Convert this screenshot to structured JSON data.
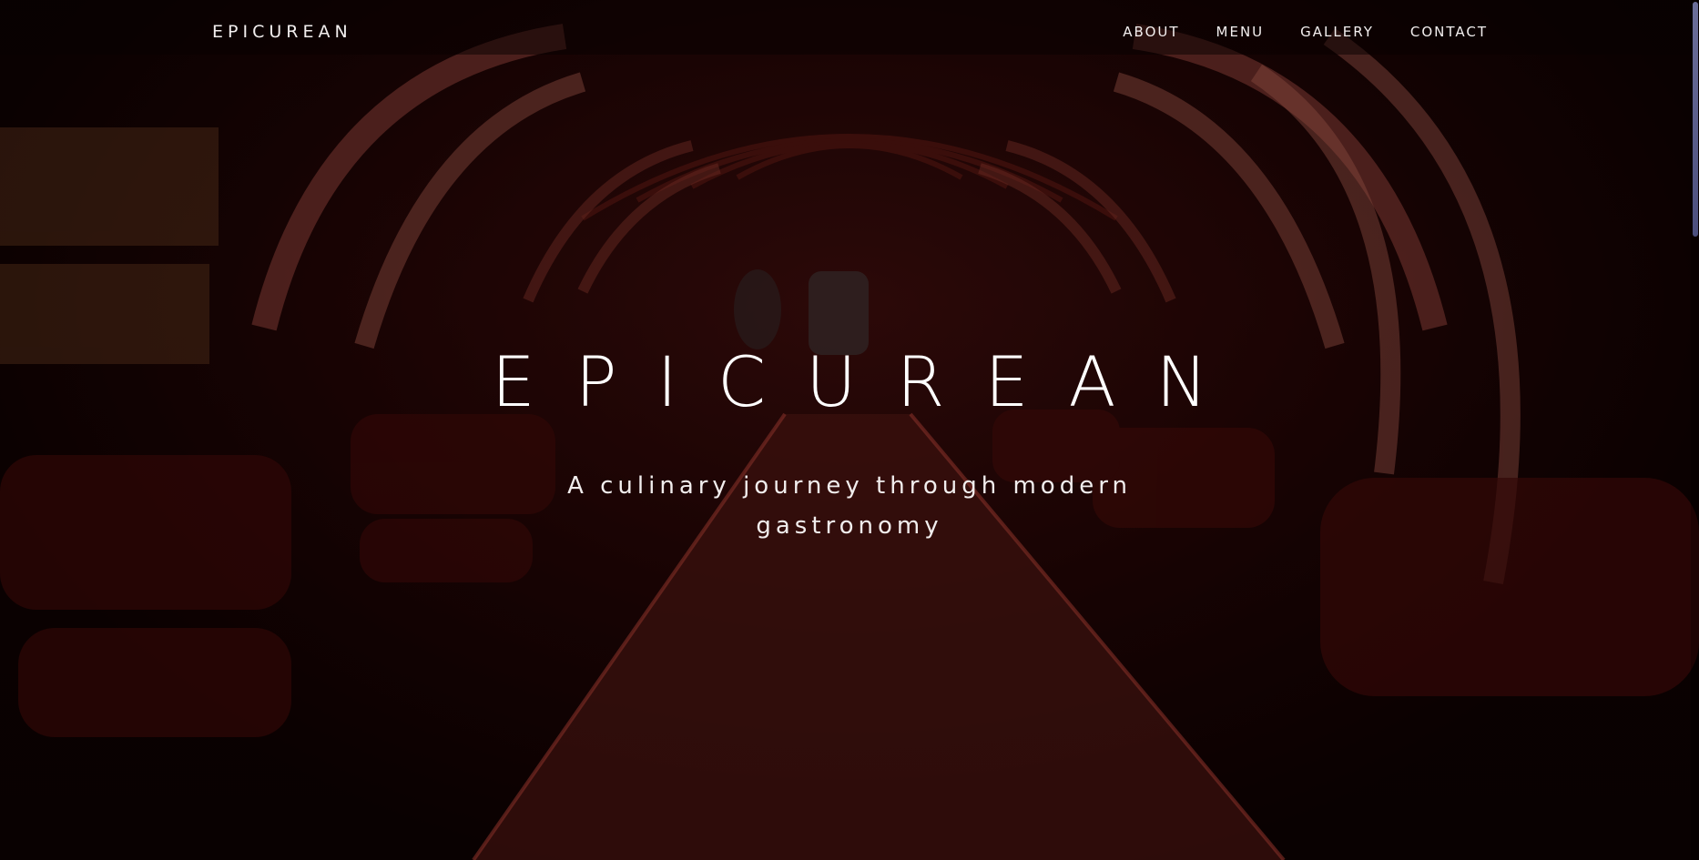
{
  "header": {
    "logo": "EPICUREAN",
    "nav": [
      {
        "label": "ABOUT"
      },
      {
        "label": "MENU"
      },
      {
        "label": "GALLERY"
      },
      {
        "label": "CONTACT"
      }
    ]
  },
  "hero": {
    "title": "EPICUREAN",
    "subtitle": "A culinary journey through modern gastronomy",
    "background": "restaurant-interior-photo"
  },
  "colors": {
    "accent": "#b3332a",
    "text": "#ffffff",
    "overlay": "#000000"
  },
  "scrollbar": {
    "position_fraction": 0.0
  }
}
